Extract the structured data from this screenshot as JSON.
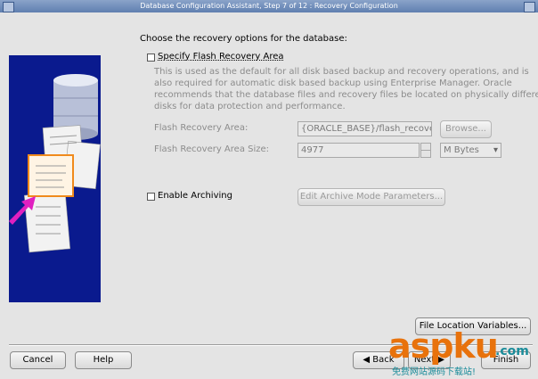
{
  "window": {
    "title": "Database Configuration Assistant, Step 7 of 12 : Recovery Configuration"
  },
  "main": {
    "heading": "Choose the recovery options for the database:",
    "flash": {
      "checkbox_label": "Specify Flash Recovery Area",
      "checked": false,
      "description_lines": [
        "This is used as the default for all disk based backup and recovery operations, and is",
        "also required for automatic disk based backup using Enterprise Manager. Oracle",
        "recommends that the database files and recovery files be located on physically different",
        "disks for data protection and performance."
      ],
      "area_label": "Flash Recovery Area:",
      "area_value": "{ORACLE_BASE}/flash_recovery_",
      "browse_label": "Browse...",
      "size_label": "Flash Recovery Area Size:",
      "size_value": "4977",
      "unit_value": "M Bytes"
    },
    "archiving": {
      "checkbox_label": "Enable Archiving",
      "checked": false,
      "params_label": "Edit Archive Mode Parameters..."
    },
    "file_location_label": "File Location Variables..."
  },
  "footer": {
    "cancel_label": "Cancel",
    "help_label": "Help",
    "back_label": "Back",
    "next_label": "Next",
    "finish_label": "Finish"
  },
  "watermark": {
    "brand": "aspku",
    "suffix": ".com",
    "tagline": "免费网站源码下载站!"
  },
  "colors": {
    "illustration_bg": "#0a1a8e",
    "watermark_orange": "#e8720c",
    "watermark_teal": "#1a8c9a"
  }
}
